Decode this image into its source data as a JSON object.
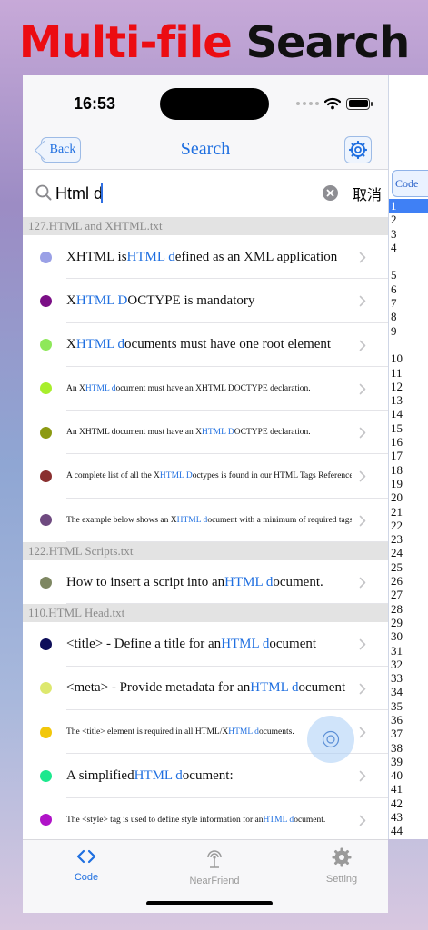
{
  "banner": {
    "part1": "Multi-file",
    "part2": "Search"
  },
  "status": {
    "time": "16:53"
  },
  "nav": {
    "back": "Back",
    "title": "Search"
  },
  "search": {
    "value": "Html d",
    "cancel": "取消"
  },
  "sections": [
    {
      "title": "127.HTML and XHTML.txt",
      "rows": [
        {
          "color": "#9aa0e6",
          "size": "large",
          "parts": [
            [
              "XHTML is ",
              false
            ],
            [
              "HTML d",
              true
            ],
            [
              "efined as an XML application",
              false
            ]
          ]
        },
        {
          "color": "#7b0f86",
          "size": "large",
          "parts": [
            [
              "X",
              false
            ],
            [
              "HTML D",
              true
            ],
            [
              "OCTYPE is mandatory",
              false
            ]
          ]
        },
        {
          "color": "#8ee85a",
          "size": "large",
          "parts": [
            [
              "X",
              false
            ],
            [
              "HTML d",
              true
            ],
            [
              "ocuments must have one root element",
              false
            ]
          ]
        },
        {
          "color": "#a8ee2c",
          "size": "small",
          "parts": [
            [
              "An X",
              false
            ],
            [
              "HTML d",
              true
            ],
            [
              "ocument must have an XHTML DOCTYPE declaration.",
              false
            ]
          ]
        },
        {
          "color": "#8c9a12",
          "size": "small",
          "parts": [
            [
              "An XHTML document must have an X",
              false
            ],
            [
              "HTML D",
              true
            ],
            [
              "OCTYPE declaration.",
              false
            ]
          ]
        },
        {
          "color": "#8a3030",
          "size": "small",
          "parts": [
            [
              "A complete list of all the X",
              false
            ],
            [
              "HTML D",
              true
            ],
            [
              "octypes is found in our HTML Tags Reference.",
              false
            ]
          ]
        },
        {
          "color": "#6f4a80",
          "size": "small",
          "parts": [
            [
              "The example below shows an X",
              false
            ],
            [
              "HTML d",
              true
            ],
            [
              "ocument with a minimum of required tags:",
              false
            ]
          ]
        }
      ]
    },
    {
      "title": "122.HTML Scripts.txt",
      "rows": [
        {
          "color": "#7e8762",
          "size": "large",
          "parts": [
            [
              "How to insert a script into an ",
              false
            ],
            [
              "HTML d",
              true
            ],
            [
              "ocument.",
              false
            ]
          ]
        }
      ]
    },
    {
      "title": "110.HTML Head.txt",
      "rows": [
        {
          "color": "#0e0e5a",
          "size": "large",
          "parts": [
            [
              "<title> - Define a title for an ",
              false
            ],
            [
              "HTML d",
              true
            ],
            [
              "ocument",
              false
            ]
          ]
        },
        {
          "color": "#dde86e",
          "size": "large",
          "parts": [
            [
              "<meta> - Provide metadata for an ",
              false
            ],
            [
              "HTML d",
              true
            ],
            [
              "ocument",
              false
            ]
          ]
        },
        {
          "color": "#f2c70a",
          "size": "small",
          "parts": [
            [
              "The <title> element is required in all HTML/X",
              false
            ],
            [
              "HTML d",
              true
            ],
            [
              "ocuments.",
              false
            ]
          ]
        },
        {
          "color": "#1de88e",
          "size": "large",
          "parts": [
            [
              "A simplified ",
              false
            ],
            [
              "HTML d",
              true
            ],
            [
              "ocument:",
              false
            ]
          ]
        },
        {
          "color": "#b013c8",
          "size": "small",
          "parts": [
            [
              "The <style> tag is used to define style information for an ",
              false
            ],
            [
              "HTML d",
              true
            ],
            [
              "ocument.",
              false
            ]
          ]
        }
      ]
    }
  ],
  "side_panel": {
    "tab_label": "Code",
    "selected": "1",
    "line_numbers": [
      "1",
      "2",
      "3",
      "4",
      "",
      "5",
      "6",
      "7",
      "8",
      "9",
      "",
      "10",
      "11",
      "12",
      "13",
      "14",
      "15",
      "16",
      "17",
      "18",
      "19",
      "20",
      "21",
      "22",
      "23",
      "24",
      "25",
      "26",
      "27",
      "28",
      "29",
      "30",
      "31",
      "32",
      "33",
      "34",
      "35",
      "36",
      "37",
      "38",
      "39",
      "40",
      "41",
      "42",
      "43",
      "44"
    ]
  },
  "tabbar": {
    "code": "Code",
    "nearfriend": "NearFriend",
    "setting": "Setting"
  },
  "colors": {
    "accent": "#1f6fe0",
    "title_red": "#ec0c12"
  }
}
